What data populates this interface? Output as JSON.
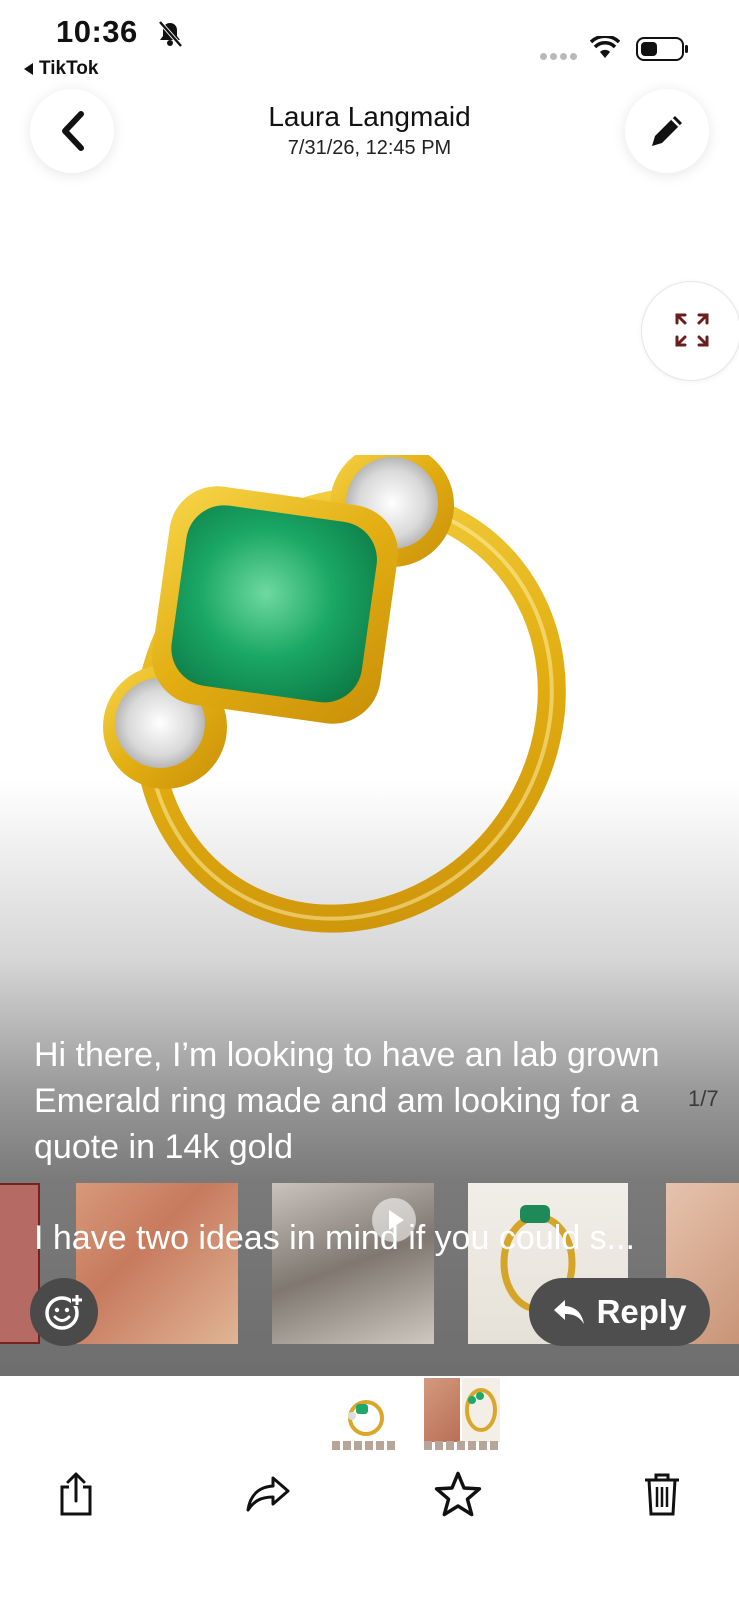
{
  "status_bar": {
    "time": "10:36",
    "back_app": "TikTok"
  },
  "header": {
    "sender": "Laura Langmaid",
    "date": "7/31/26, 12:45 PM"
  },
  "photo": {
    "caption": "Hi there, I’m looking to have an lab grown Emerald ring made and am looking for a quote in 14k gold",
    "caption_continued": "I have two ideas in mind if you could s...",
    "page_indicator": "1/7"
  },
  "actions": {
    "reply_label": "Reply"
  },
  "toolbar": {
    "items": [
      "share-icon",
      "forward-icon",
      "star-icon",
      "trash-icon"
    ]
  },
  "colors": {
    "gold": "#e8b81a",
    "emerald": "#1fa86a",
    "accent_dark": "#6b1c1c"
  }
}
